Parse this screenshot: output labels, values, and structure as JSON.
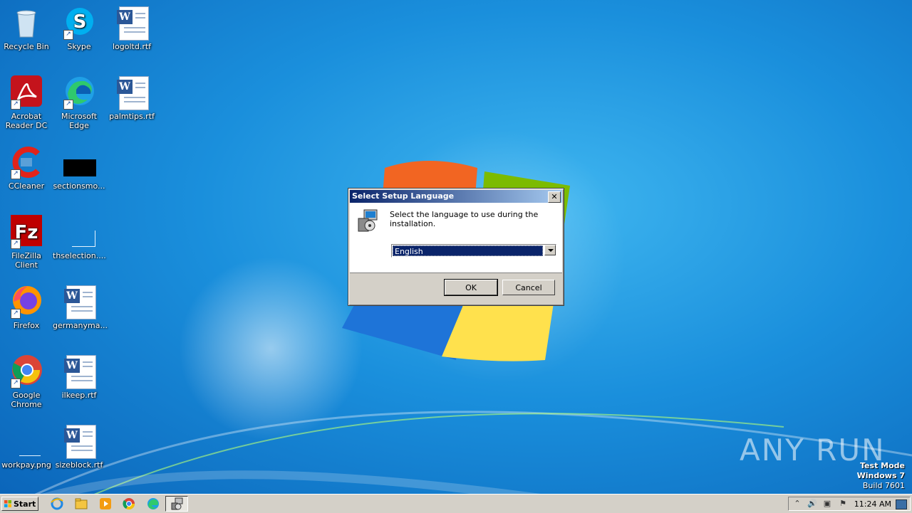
{
  "desktop": {
    "icons": [
      {
        "label": "Recycle Bin",
        "icon": "recycle-bin-icon"
      },
      {
        "label": "Skype",
        "icon": "skype-icon"
      },
      {
        "label": "logoltd.rtf",
        "icon": "word-document-icon"
      },
      {
        "label": "Acrobat Reader DC",
        "icon": "acrobat-reader-icon"
      },
      {
        "label": "Microsoft Edge",
        "icon": "edge-icon"
      },
      {
        "label": "palmtips.rtf",
        "icon": "word-document-icon"
      },
      {
        "label": "CCleaner",
        "icon": "ccleaner-icon"
      },
      {
        "label": "sectionsmo...",
        "icon": "black-image-icon"
      },
      {
        "label": "FileZilla Client",
        "icon": "filezilla-icon"
      },
      {
        "label": "thselection....",
        "icon": "image-file-icon"
      },
      {
        "label": "Firefox",
        "icon": "firefox-icon"
      },
      {
        "label": "germanyma...",
        "icon": "word-document-icon"
      },
      {
        "label": "Google Chrome",
        "icon": "chrome-icon"
      },
      {
        "label": "ilkeep.rtf",
        "icon": "word-document-icon"
      },
      {
        "label": "workpay.png",
        "icon": "image-file-icon"
      },
      {
        "label": "sizeblock.rtf",
        "icon": "word-document-icon"
      }
    ]
  },
  "dialog": {
    "title": "Select Setup Language",
    "prompt": "Select the language to use during the installation.",
    "selected_language": "English",
    "ok_label": "OK",
    "cancel_label": "Cancel",
    "close_glyph": "✕"
  },
  "taskbar": {
    "start_label": "Start",
    "clock": "11:24 AM"
  },
  "watermark": {
    "line1": "Test Mode",
    "line2": "Windows 7",
    "line3": "Build 7601",
    "brand": "ANY RUN"
  },
  "colors": {
    "title_bar_start": "#0a246a",
    "title_bar_end": "#a6caf0",
    "selection": "#0a246a",
    "desktop_blue": "#1a8fdc"
  }
}
